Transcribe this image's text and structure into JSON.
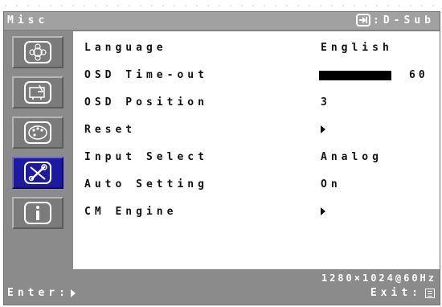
{
  "header": {
    "title": "Misc",
    "source_label": ":D-Sub",
    "source_icon": "input-source-icon"
  },
  "sidebar": {
    "items": [
      {
        "icon": "picture-icon",
        "active": false
      },
      {
        "icon": "osd-settings-icon",
        "active": false
      },
      {
        "icon": "color-palette-icon",
        "active": false
      },
      {
        "icon": "tools-icon",
        "active": true
      },
      {
        "icon": "information-icon",
        "active": false
      }
    ]
  },
  "menu": {
    "rows": [
      {
        "label": "Language",
        "value": "English"
      },
      {
        "label": "OSD Time-out",
        "value": "60",
        "fill": 0.72
      },
      {
        "label": "OSD Position",
        "value": "3"
      },
      {
        "label": "Reset",
        "value": "",
        "value_icon": "arrow-right-icon"
      },
      {
        "label": "Input Select",
        "value": "Analog"
      },
      {
        "label": "Auto Setting",
        "value": "On"
      },
      {
        "label": "CM Engine",
        "value": "",
        "value_icon": "arrow-right-icon"
      }
    ]
  },
  "footer": {
    "resolution": "1280×1024@60Hz",
    "enter_label": "Enter:",
    "exit_label": "Exit:"
  },
  "colors": {
    "frame": "#8b8b8b",
    "titlebar": "#a1a1a1",
    "active": "#1e1aa0",
    "panel": "#ffffff"
  }
}
